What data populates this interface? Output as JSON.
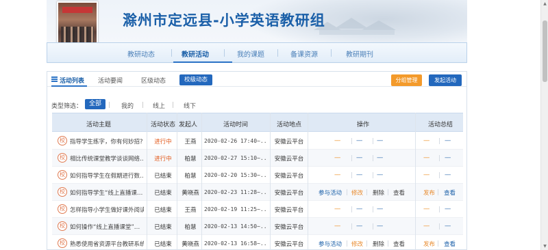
{
  "site": {
    "title": "滁州市定远县-小学英语教研组"
  },
  "mainnav": {
    "items": [
      {
        "label": "教研动态",
        "active": false
      },
      {
        "label": "教研活动",
        "active": true
      },
      {
        "label": "我的课题",
        "active": false
      },
      {
        "label": "备课资源",
        "active": false
      },
      {
        "label": "教研期刊",
        "active": false
      }
    ]
  },
  "subtabs": {
    "items": [
      "活动列表",
      "活动要闻",
      "区级动态",
      "校级动态"
    ],
    "group_manage": "分组管理",
    "start_activity": "发起活动"
  },
  "filter": {
    "label": "类型筛选：",
    "options": [
      "全部",
      "我的",
      "线上",
      "线下"
    ],
    "selected": "全部"
  },
  "table": {
    "headers": [
      "活动主题",
      "活动状态",
      "发起人",
      "活动时间",
      "活动地点",
      "操作",
      "活动总结"
    ],
    "badge": "校",
    "dash": "----",
    "rows": [
      {
        "topic": "指导学生练字，你有何妙招?",
        "status": "进行中",
        "initiator": "王燕",
        "time": "2020-02-26 17:40~...",
        "place": "安徽云平台",
        "ops": [],
        "summary": []
      },
      {
        "topic": "相比传统课堂教学谈谈网络…",
        "status": "进行中",
        "initiator": "柏慧",
        "time": "2020-02-27 15:10~...",
        "place": "安徽云平台",
        "ops": [],
        "summary": []
      },
      {
        "topic": "如何指导学生在假期进行数…",
        "status": "已结束",
        "initiator": "柏慧",
        "time": "2020-02-20 15:30~...",
        "place": "安徽云平台",
        "ops": [],
        "summary": []
      },
      {
        "topic": "如何指导学生“线上直播课…",
        "status": "已结束",
        "initiator": "黄晓燕",
        "time": "2020-02-23 11:28~...",
        "place": "安徽云平台",
        "ops": [
          "参与活动",
          "修改",
          "删除",
          "查看"
        ],
        "summary": [
          "发布",
          "查看"
        ]
      },
      {
        "topic": "怎样指导小学生做好课外阅读",
        "status": "已结束",
        "initiator": "王燕",
        "time": "2020-02-19 11:25~...",
        "place": "安徽云平台",
        "ops": [],
        "summary": []
      },
      {
        "topic": "如何操作“线上直播课堂”…",
        "status": "已结束",
        "initiator": "柏慧",
        "time": "2020-02-13 14:50~...",
        "place": "安徽云平台",
        "ops": [],
        "summary": []
      },
      {
        "topic": "熟悉使用省资源平台教研系统",
        "status": "已结束",
        "initiator": "黄晓燕",
        "time": "2020-02-13 16:58~...",
        "place": "安徽云平台",
        "ops": [
          "参与活动",
          "修改",
          "删除",
          "查看"
        ],
        "summary": [
          "发布",
          "查看"
        ]
      }
    ]
  },
  "colors": {
    "accent": "#2368bd",
    "orange": "#f39a2b",
    "in_progress": "#e25a1c",
    "badge": "#e07a50"
  }
}
